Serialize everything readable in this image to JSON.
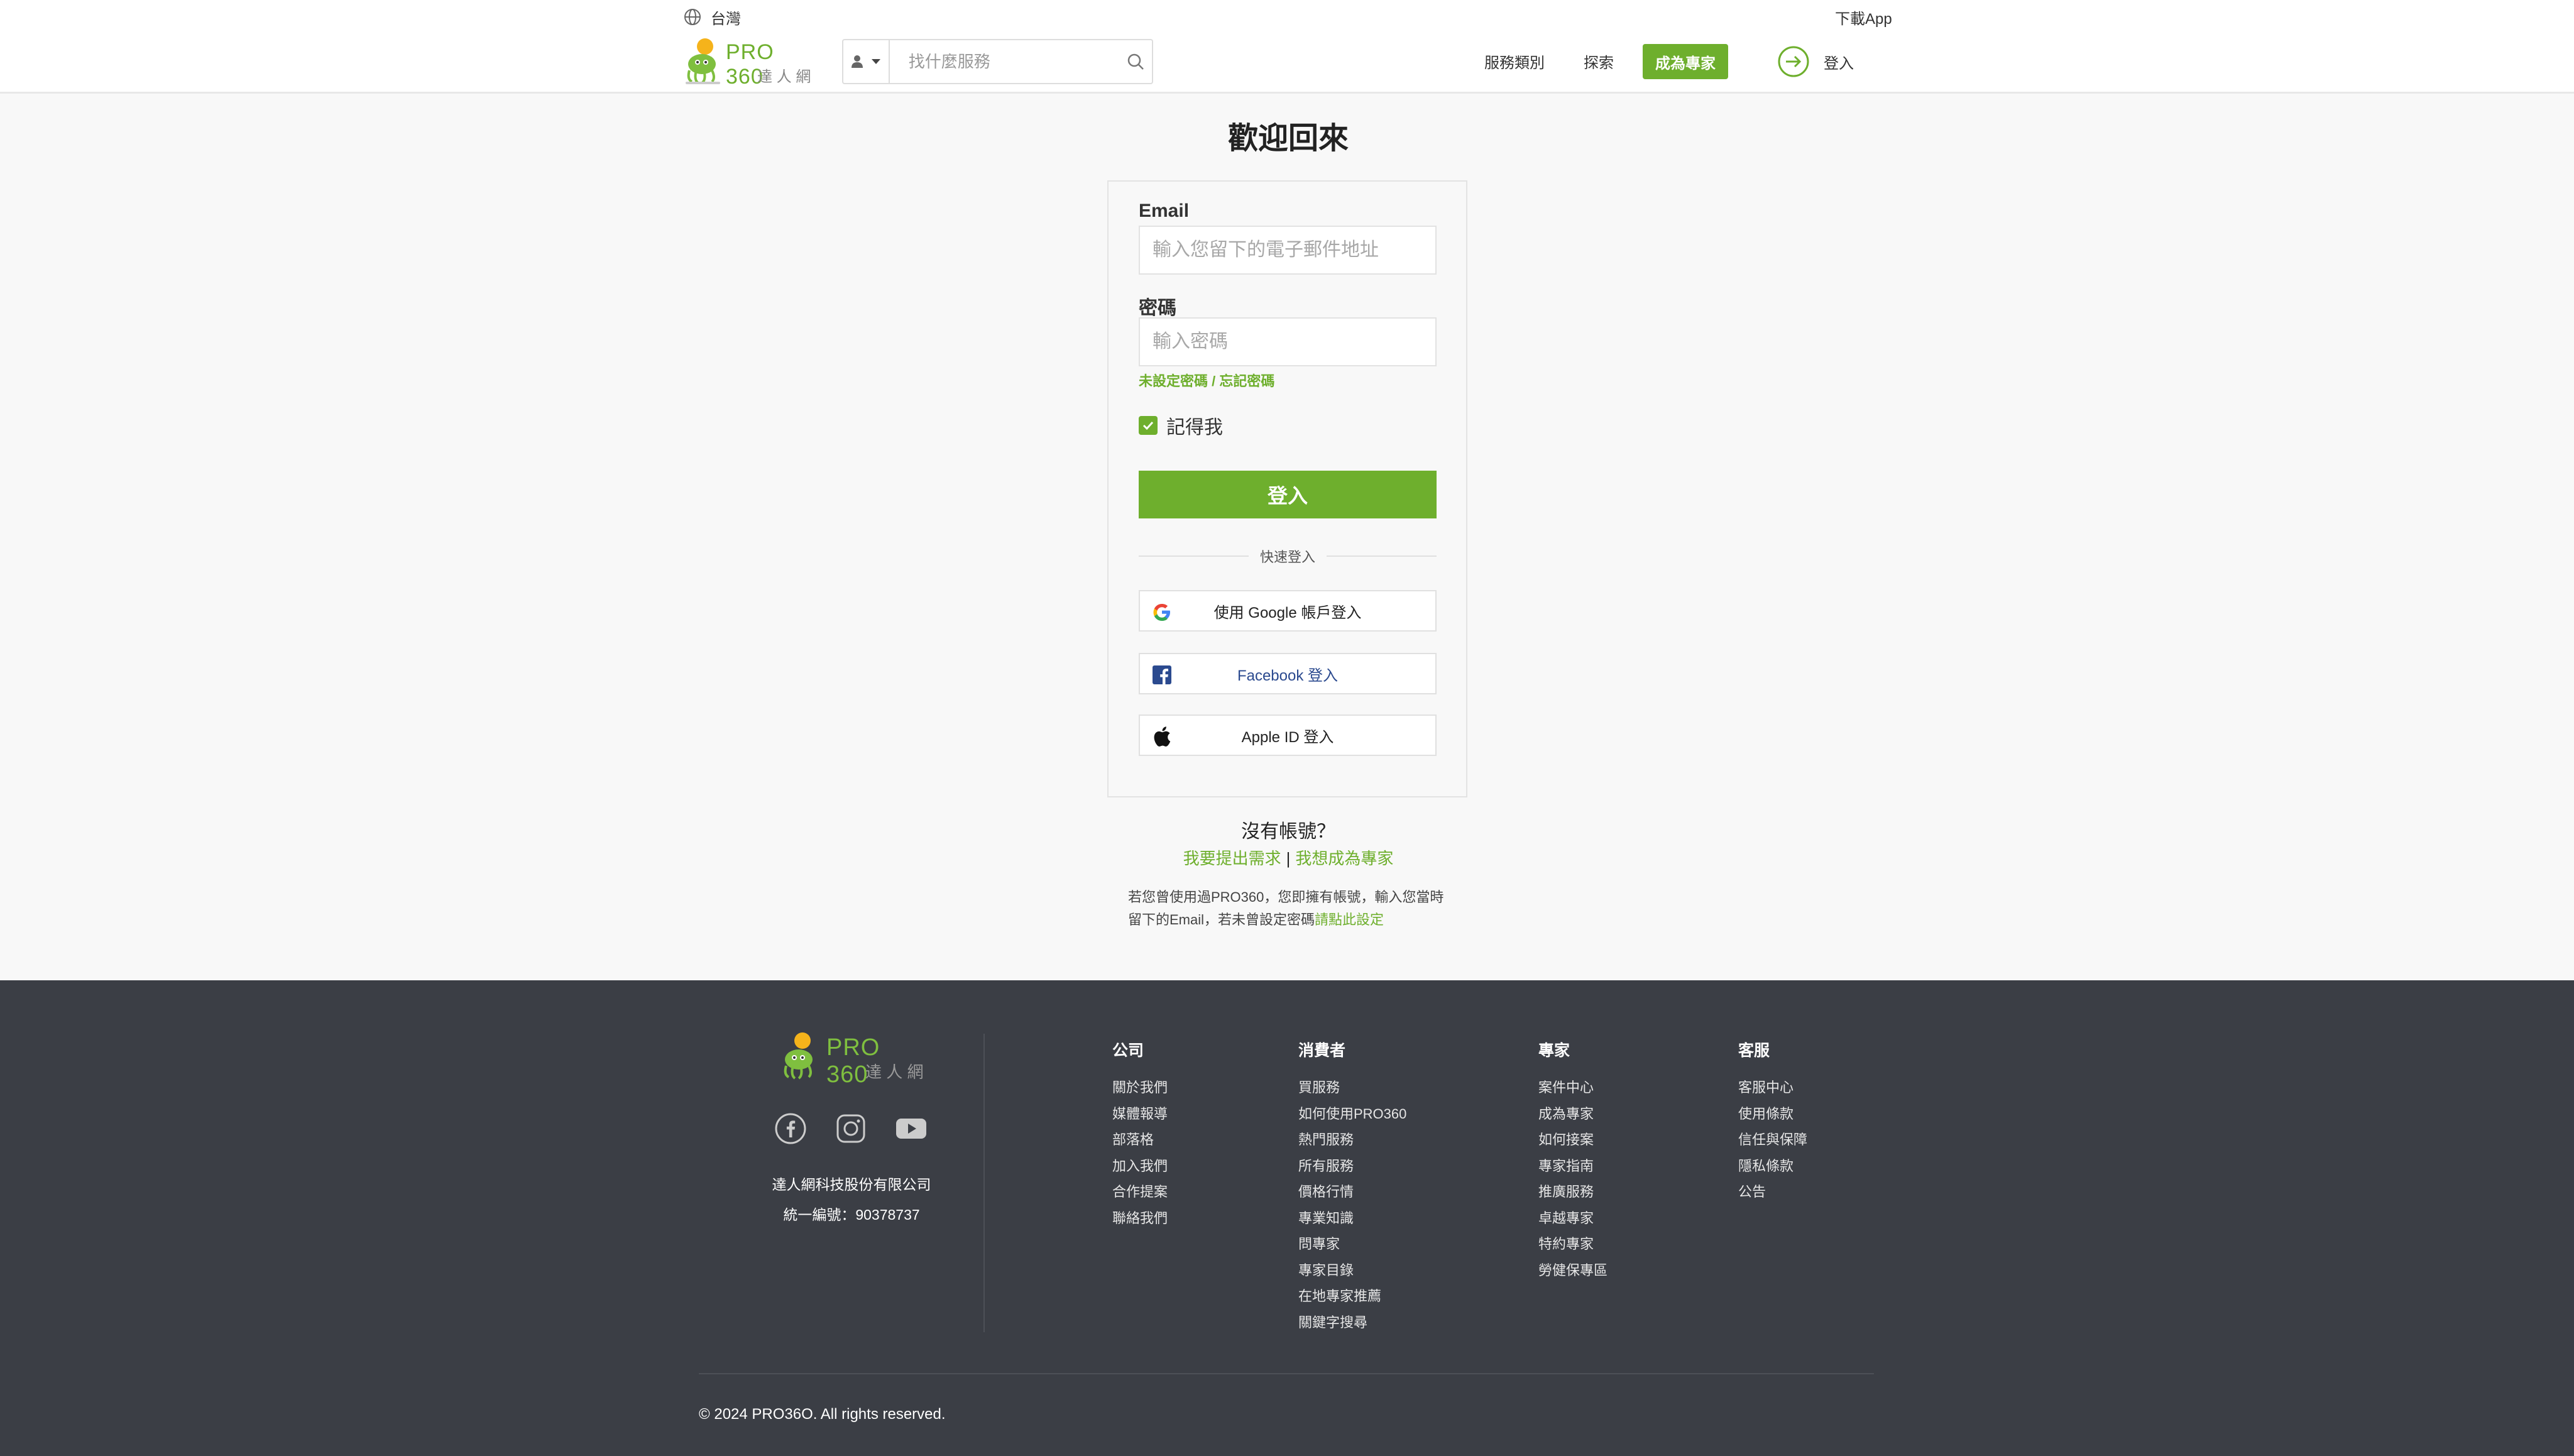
{
  "colors": {
    "brand_green": "#6eaf2d",
    "footer_bg": "#3b3e45",
    "facebook_blue": "#2b4a8f"
  },
  "header": {
    "region": "台灣",
    "download_app": "下載App",
    "logo": {
      "brand": "PRO 360",
      "subtitle": "達 人 網"
    },
    "search": {
      "role_icon": "user-icon",
      "placeholder": "找什麼服務"
    },
    "nav": {
      "categories": "服務類別",
      "explore": "探索",
      "become_pro": "成為專家",
      "login": "登入"
    }
  },
  "main": {
    "welcome": "歡迎回來",
    "form": {
      "email_label": "Email",
      "email_placeholder": "輸入您留下的電子郵件地址",
      "password_label": "密碼",
      "password_placeholder": "輸入密碼",
      "forgot_link": "未設定密碼 / 忘記密碼",
      "remember_me": "記得我",
      "remember_checked": true,
      "login_button": "登入",
      "quick_login": "快速登入",
      "google_login": "使用 Google 帳戶登入",
      "facebook_login": "Facebook 登入",
      "apple_login": "Apple ID 登入"
    },
    "no_account": "沒有帳號？",
    "signup_request": "我要提出需求",
    "signup_separator": "|",
    "signup_pro": "我想成為專家",
    "note_text": "若您曾使用過PRO360，您即擁有帳號，輸入您當時留下的Email，若未曾設定密碼",
    "note_link": "請點此設定"
  },
  "footer": {
    "logo": {
      "brand": "PRO 360",
      "subtitle": "達 人 網"
    },
    "company_name": "達人網科技股份有限公司",
    "tax_id": "統一編號：90378737",
    "columns": [
      {
        "title": "公司",
        "links": [
          "關於我們",
          "媒體報導",
          "部落格",
          "加入我們",
          "合作提案",
          "聯絡我們"
        ]
      },
      {
        "title": "消費者",
        "links": [
          "買服務",
          "如何使用PRO360",
          "熱門服務",
          "所有服務",
          "價格行情",
          "專業知識",
          "問專家",
          "專家目錄",
          "在地專家推薦",
          "關鍵字搜尋"
        ]
      },
      {
        "title": "專家",
        "links": [
          "案件中心",
          "成為專家",
          "如何接案",
          "專家指南",
          "推廣服務",
          "卓越專家",
          "特約專家",
          "勞健保專區"
        ]
      },
      {
        "title": "客服",
        "links": [
          "客服中心",
          "使用條款",
          "信任與保障",
          "隱私條款",
          "公告"
        ]
      }
    ],
    "copyright": "© 2024 PRO36O. All rights reserved."
  }
}
